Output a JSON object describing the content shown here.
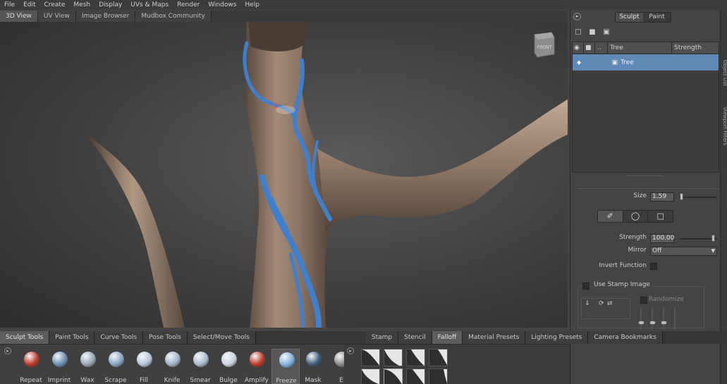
{
  "menu": [
    "File",
    "Edit",
    "Create",
    "Mesh",
    "Display",
    "UVs & Maps",
    "Render",
    "Windows",
    "Help"
  ],
  "view_tabs": [
    {
      "label": "3D View",
      "active": true
    },
    {
      "label": "UV View",
      "active": false
    },
    {
      "label": "Image Browser",
      "active": false
    },
    {
      "label": "Mudbox Community",
      "active": false
    }
  ],
  "viewcube_label": "FRONT",
  "right_panel": {
    "toggle_icon": "arrow-right-icon",
    "modes": [
      {
        "label": "Sculpt",
        "active": true
      },
      {
        "label": "Paint",
        "active": false
      }
    ],
    "layer_actions": [
      "new-layer-icon",
      "delete-layer-icon",
      "merge-layer-icon"
    ],
    "columns": [
      "Tree",
      "Strength"
    ],
    "layers": [
      {
        "name": "Tree",
        "icon": "mesh-cube-icon",
        "selected": true
      }
    ]
  },
  "properties": {
    "size_label": "Size",
    "size_value": "1.59",
    "brush_modes": [
      "brush-icon",
      "lasso-icon",
      "rect-select-icon"
    ],
    "strength_label": "Strength",
    "strength_value": "100.00",
    "mirror_label": "Mirror",
    "mirror_value": "Off",
    "invert_label": "Invert Function",
    "stamp_label": "Use Stamp Image",
    "randomize_label": "Randomize"
  },
  "side_tabs": [
    "Object List",
    "Viewport Filters"
  ],
  "bottom_tabs_left": [
    {
      "label": "Sculpt Tools",
      "active": true
    },
    {
      "label": "Paint Tools",
      "active": false
    },
    {
      "label": "Curve Tools",
      "active": false
    },
    {
      "label": "Pose Tools",
      "active": false
    },
    {
      "label": "Select/Move Tools",
      "active": false
    }
  ],
  "bottom_tabs_right": [
    {
      "label": "Stamp",
      "active": false
    },
    {
      "label": "Stencil",
      "active": false
    },
    {
      "label": "Falloff",
      "active": true
    },
    {
      "label": "Material Presets",
      "active": false
    },
    {
      "label": "Lighting Presets",
      "active": false
    },
    {
      "label": "Camera Bookmarks",
      "active": false
    }
  ],
  "tools": [
    {
      "label": "Repeat",
      "icon": "repeat-icon",
      "color": "#c0392b",
      "active": false
    },
    {
      "label": "Imprint",
      "icon": "imprint-icon",
      "color": "#6a8fb5",
      "active": false
    },
    {
      "label": "Wax",
      "icon": "wax-icon",
      "color": "#9aa7b6",
      "active": false
    },
    {
      "label": "Scrape",
      "icon": "scrape-icon",
      "color": "#8aa4c4",
      "active": false
    },
    {
      "label": "Fill",
      "icon": "fill-icon",
      "color": "#b5c7dc",
      "active": false
    },
    {
      "label": "Knife",
      "icon": "knife-icon",
      "color": "#9fb3c7",
      "active": false
    },
    {
      "label": "Smear",
      "icon": "smear-icon",
      "color": "#a9bcd1",
      "active": false
    },
    {
      "label": "Bulge",
      "icon": "bulge-icon",
      "color": "#c9d3de",
      "active": false
    },
    {
      "label": "Amplify",
      "icon": "amplify-icon",
      "color": "#c0392b",
      "active": false
    },
    {
      "label": "Freeze",
      "icon": "freeze-icon",
      "color": "#7fb0e0",
      "active": true
    },
    {
      "label": "Mask",
      "icon": "mask-icon",
      "color": "#3c5a78",
      "active": false
    },
    {
      "label": "E",
      "icon": "erase-icon",
      "color": "#888",
      "active": false
    }
  ],
  "colors": {
    "selection_blue": "#6089b8",
    "freeze_paint": "#3f7fd0",
    "tree_skin": "#8a7260"
  }
}
